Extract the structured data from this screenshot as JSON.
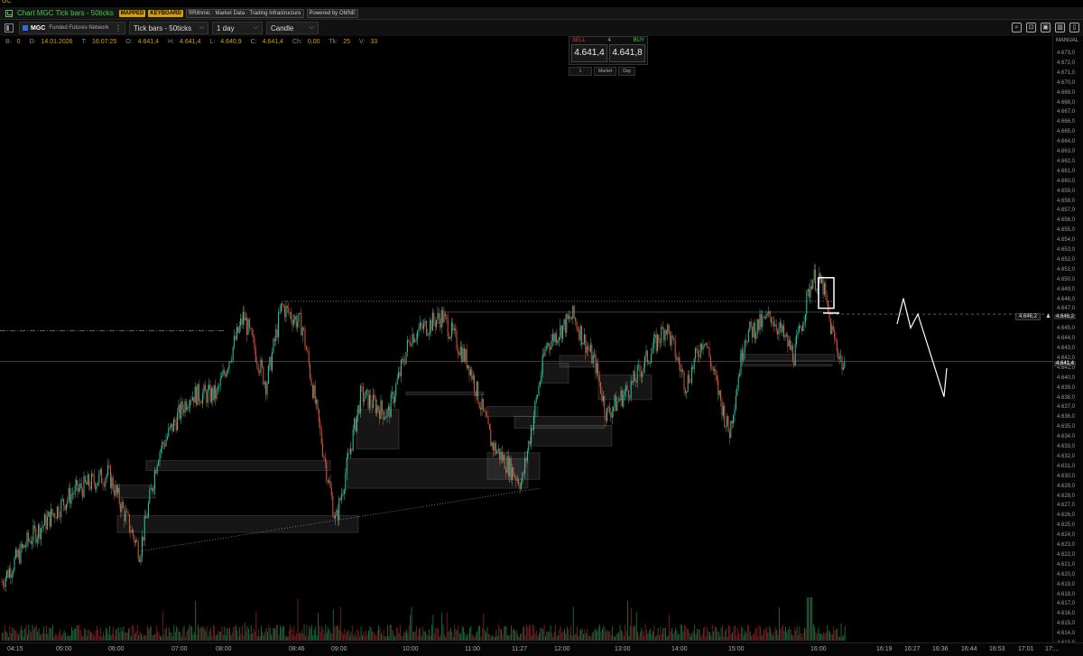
{
  "window": {
    "corner_label": "GC",
    "title": "Chart MGC Tick bars - 50ticks",
    "badges": {
      "mapped": "MAPPED",
      "keyboard": "KEYBOARD",
      "rithmic": "®Rithmic · Market Data · Trading Infrastructure",
      "omne": "Powered by OMNE"
    }
  },
  "toolbar": {
    "symbol": "MGC",
    "account": "Funded Futures Network",
    "bar_type": "Tick bars - 50ticks",
    "period": "1 day",
    "style": "Candle"
  },
  "ohlc": [
    {
      "label": "B:",
      "value": "0"
    },
    {
      "label": "D:",
      "value": "14.01.2026"
    },
    {
      "label": "T:",
      "value": "16:07:25"
    },
    {
      "label": "O:",
      "value": "4.641,4"
    },
    {
      "label": "H:",
      "value": "4.641,4"
    },
    {
      "label": "L:",
      "value": "4.640,9"
    },
    {
      "label": "C:",
      "value": "4.641,4"
    },
    {
      "label": "Ch:",
      "value": "0,00"
    },
    {
      "label": "Tk:",
      "value": "25"
    },
    {
      "label": "V:",
      "value": "33"
    }
  ],
  "trade_panel": {
    "sell_label": "SELL",
    "buy_label": "BUY",
    "spread": "4",
    "sell_price": "4.641,4",
    "buy_price": "4.641,8",
    "quantity": "1",
    "order_type": "Market",
    "tif": "Day"
  },
  "price_axis": {
    "mode": "MANUAL",
    "labels": [
      "4.673,0",
      "4.672,0",
      "4.671,0",
      "4.670,0",
      "4.669,0",
      "4.668,0",
      "4.667,0",
      "4.666,0",
      "4.665,0",
      "4.664,0",
      "4.663,0",
      "4.662,0",
      "4.661,0",
      "4.660,0",
      "4.659,0",
      "4.658,0",
      "4.657,0",
      "4.656,0",
      "4.655,0",
      "4.654,0",
      "4.653,0",
      "4.652,0",
      "4.651,0",
      "4.650,0",
      "4.649,0",
      "4.648,0",
      "4.647,0",
      "4.646,0",
      "4.645,0",
      "4.644,0",
      "4.643,0",
      "4.642,0",
      "4.641,0",
      "4.640,0",
      "4.639,0",
      "4.638,0",
      "4.637,0",
      "4.636,0",
      "4.635,0",
      "4.634,0",
      "4.633,0",
      "4.632,0",
      "4.631,0",
      "4.630,0",
      "4.629,0",
      "4.628,0",
      "4.627,0",
      "4.626,0",
      "4.625,0",
      "4.624,0",
      "4.623,0",
      "4.622,0",
      "4.621,0",
      "4.620,0",
      "4.619,0",
      "4.618,0",
      "4.617,0",
      "4.616,0",
      "4.615,0",
      "4.614,0",
      "4.613,0"
    ],
    "alert_price": "4.646,2",
    "current_price": "4.641,4"
  },
  "time_axis": {
    "labels": [
      "04:15",
      "05:00",
      "06:00",
      "07:00",
      "08:00",
      "08:46",
      "09:00",
      "10:00",
      "11:00",
      "11:27",
      "12:00",
      "13:00",
      "14:00",
      "15:00",
      "16:00",
      "16:19",
      "16:27",
      "16:36",
      "16:44",
      "16:53",
      "17:01",
      "17:..."
    ]
  },
  "colors": {
    "up": "#2ec9a8",
    "down": "#e0583a",
    "accent": "#d4a300",
    "green": "#3fd03f"
  }
}
